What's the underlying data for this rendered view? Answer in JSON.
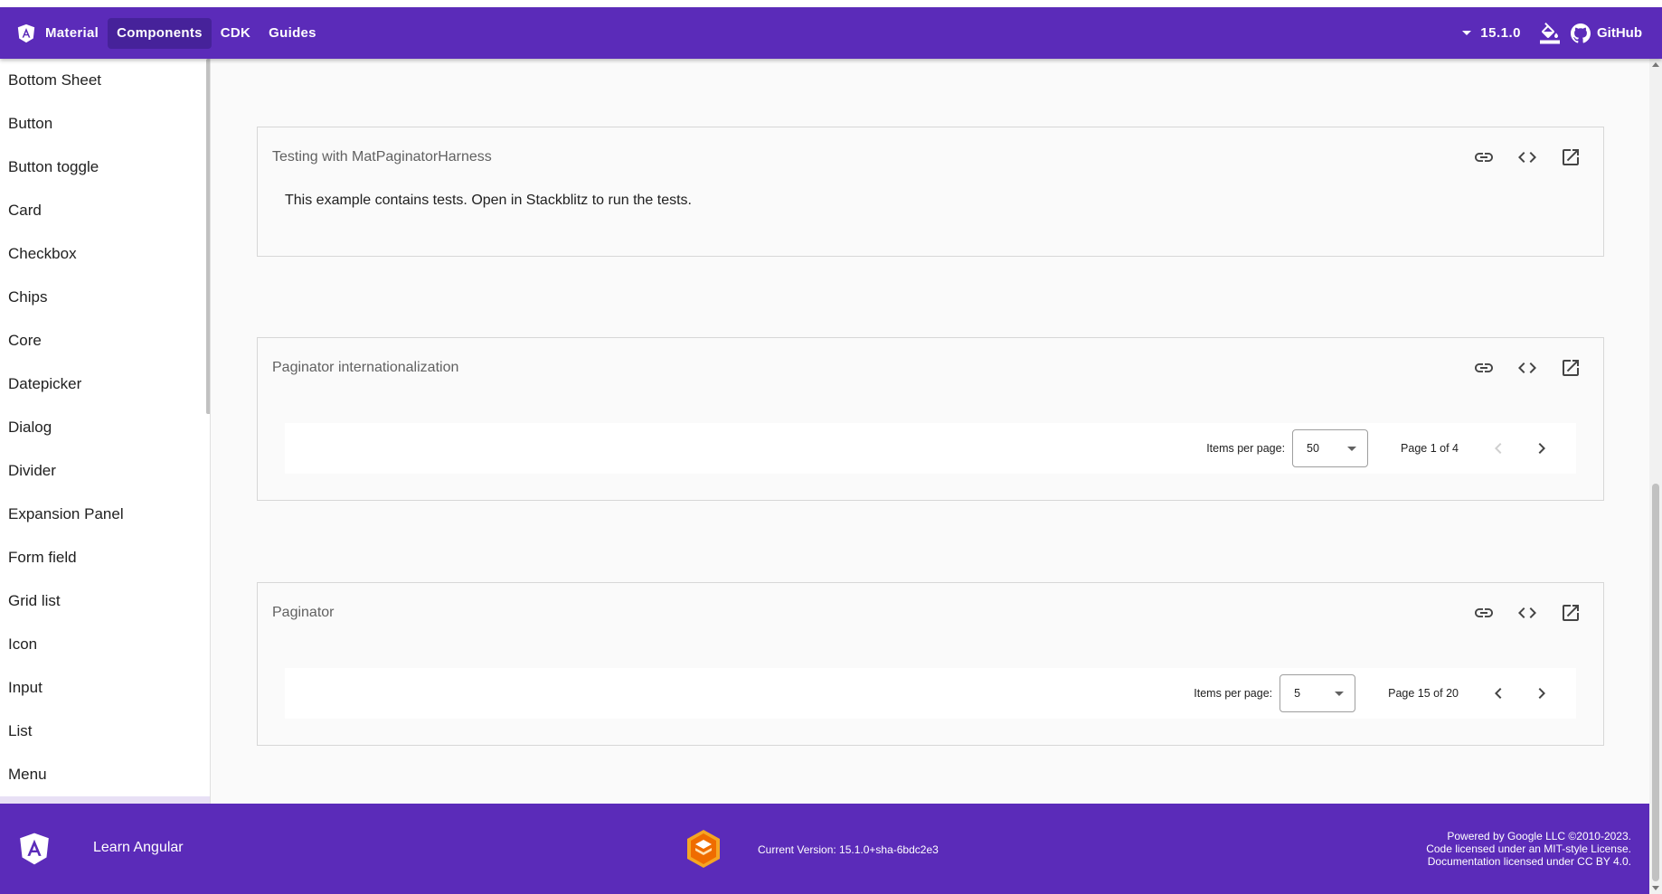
{
  "nav": {
    "brand": "Material",
    "links": [
      "Components",
      "CDK",
      "Guides"
    ],
    "version": "15.1.0",
    "github": "GitHub"
  },
  "sidebar": {
    "items": [
      {
        "label": "Bottom Sheet"
      },
      {
        "label": "Button"
      },
      {
        "label": "Button toggle"
      },
      {
        "label": "Card"
      },
      {
        "label": "Checkbox"
      },
      {
        "label": "Chips"
      },
      {
        "label": "Core"
      },
      {
        "label": "Datepicker"
      },
      {
        "label": "Dialog"
      },
      {
        "label": "Divider"
      },
      {
        "label": "Expansion Panel"
      },
      {
        "label": "Form field"
      },
      {
        "label": "Grid list"
      },
      {
        "label": "Icon"
      },
      {
        "label": "Input"
      },
      {
        "label": "List"
      },
      {
        "label": "Menu"
      }
    ]
  },
  "examples": [
    {
      "title": "Testing with MatPaginatorHarness",
      "text": "This example contains tests. Open in Stackblitz to run the tests."
    },
    {
      "title": "Paginator internationalization",
      "paginator": {
        "label": "Items per page:",
        "page_size": "50",
        "range": "Page 1 of 4",
        "prev_enabled": false,
        "next_enabled": true
      }
    },
    {
      "title": "Paginator",
      "paginator": {
        "label": "Items per page:",
        "page_size": "5",
        "range": "Page 15 of 20",
        "prev_enabled": true,
        "next_enabled": true
      }
    }
  ],
  "footer": {
    "learn": "Learn Angular",
    "version": "Current Version: 15.1.0+sha-6bdc2e3",
    "legal": [
      "Powered by Google LLC ©2010-2023.",
      "Code licensed under an MIT-style License.",
      "Documentation licensed under CC BY 4.0."
    ]
  },
  "colors": {
    "primary": "#5b2bb9",
    "nav_active": "#46229a",
    "sidebar_selected": "#e8e0f5"
  }
}
